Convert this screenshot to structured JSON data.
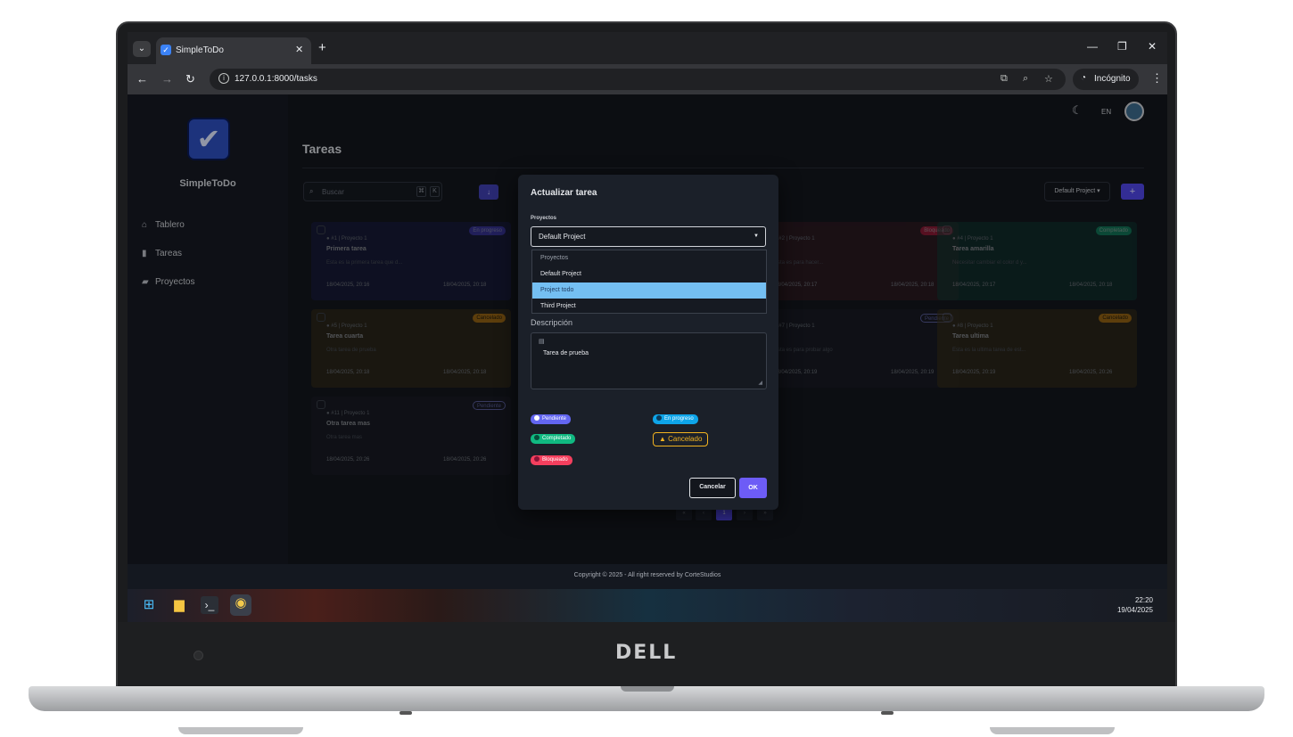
{
  "device": {
    "brand": "DELL"
  },
  "browser": {
    "tab_title": "SimpleToDo",
    "url": "127.0.0.1:8000/tasks",
    "incognito_label": "Incógnito"
  },
  "app": {
    "name": "SimpleToDo",
    "lang": "EN",
    "sidebar": {
      "items": [
        {
          "label": "Tablero",
          "icon": "home-icon"
        },
        {
          "label": "Tareas",
          "icon": "clipboard-icon"
        },
        {
          "label": "Proyectos",
          "icon": "folder-icon"
        }
      ]
    },
    "page_title": "Tareas",
    "search": {
      "placeholder": "Buscar",
      "kbd": [
        "⌘",
        "K"
      ]
    },
    "project_filter": "Default Project ▾",
    "tasks": [
      {
        "meta": "● #1 | Proyecto 1",
        "title": "Primera tarea",
        "desc": "Esta es la primera tarea que d...",
        "created": "18/04/2025, 20:16",
        "updated": "18/04/2025, 20:18",
        "status": "En progreso"
      },
      {
        "meta": "● #2 | Proyecto 1",
        "title": "",
        "desc": "Esta es para hacer...",
        "created": "18/04/2025, 20:17",
        "updated": "18/04/2025, 20:18",
        "status": "Bloqueado"
      },
      {
        "meta": "● #4 | Proyecto 1",
        "title": "Tarea amarilla",
        "desc": "Necesitar cambiar el color d y...",
        "created": "18/04/2025, 20:17",
        "updated": "18/04/2025, 20:18",
        "status": "Completado"
      },
      {
        "meta": "● #5 | Proyecto 1",
        "title": "Tarea cuarta",
        "desc": "Otra tarea de prueba",
        "created": "18/04/2025, 20:18",
        "updated": "18/04/2025, 20:18",
        "status": "Cancelado"
      },
      {
        "meta": "● #7 | Proyecto 1",
        "title": "",
        "desc": "Esta es para probar algo",
        "created": "18/04/2025, 20:19",
        "updated": "18/04/2025, 20:19",
        "status": "Pendiente"
      },
      {
        "meta": "● #8 | Proyecto 1",
        "title": "Tarea ultima",
        "desc": "Esta es la ultima tarea de est...",
        "created": "18/04/2025, 20:19",
        "updated": "18/04/2025, 20:26",
        "status": "Cancelado"
      },
      {
        "meta": "● #11 | Proyecto 1",
        "title": "Otra tarea mas",
        "desc": "Otra tarea mas",
        "created": "18/04/2025, 20:26",
        "updated": "18/04/2025, 20:26",
        "status": "Pendiente"
      }
    ],
    "pagination": {
      "prev_first": "«",
      "prev": "‹",
      "current": "1",
      "next": "›",
      "next_last": "»"
    },
    "footer": "Copyright © 2025 - All right reserved by CorteStudios"
  },
  "modal": {
    "title": "Actualizar tarea",
    "project_label": "Proyectos",
    "project_selected": "Default Project",
    "project_options": [
      {
        "label": "Proyectos",
        "kind": "header"
      },
      {
        "label": "Default Project",
        "kind": "option"
      },
      {
        "label": "Project todo",
        "kind": "highlight"
      },
      {
        "label": "Third Project",
        "kind": "option"
      }
    ],
    "description_label": "Descripción",
    "description_value": "Tarea de prueba",
    "statuses": [
      {
        "label": "Pendiente",
        "color": "#6366f1"
      },
      {
        "label": "En progreso",
        "color": "#0ea5e9"
      },
      {
        "label": "Completado",
        "color": "#10b981"
      },
      {
        "label": "Cancelado",
        "color": "#f2b320"
      },
      {
        "label": "Bloqueado",
        "color": "#f43f5e"
      }
    ],
    "selected_status": "Cancelado",
    "cancel_label": "Cancelar",
    "ok_label": "OK"
  },
  "taskbar": {
    "time": "22:20",
    "date": "19/04/2025"
  },
  "colors": {
    "status": {
      "En progreso": {
        "bg": "#1a1f4a",
        "badge": "#4f46e5",
        "text": "#c8ccff"
      },
      "Bloqueado": {
        "bg": "#3a1c24",
        "badge": "#e11d48",
        "text": "#ffd0d8"
      },
      "Completado": {
        "bg": "#0f3b33",
        "badge": "#10b981",
        "text": "#d1fae5"
      },
      "Cancelado": {
        "bg": "#3a3116",
        "badge": "#f59e0b",
        "text": "#2a1d00"
      },
      "Pendiente": {
        "bg": "#1b1f28",
        "badge": "transparent",
        "text": "#8b8ff0"
      }
    }
  }
}
